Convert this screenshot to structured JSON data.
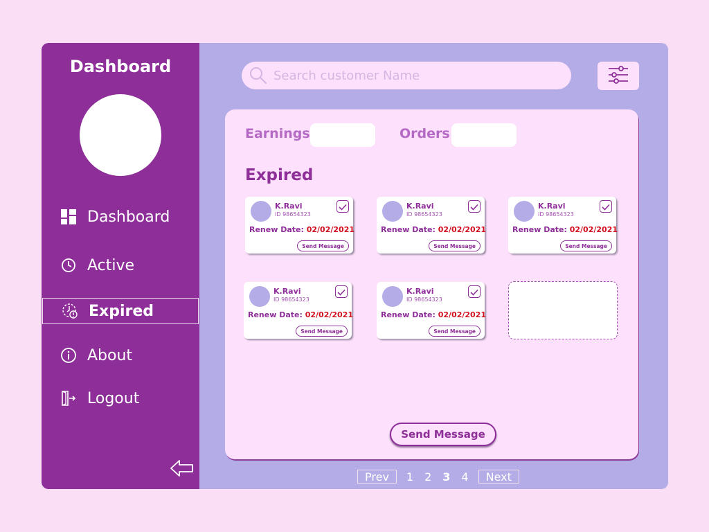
{
  "sidebar": {
    "title": "Dashboard",
    "items": [
      {
        "label": "Dashboard",
        "icon": "grid-icon"
      },
      {
        "label": "Active",
        "icon": "clock-icon"
      },
      {
        "label": "Expired",
        "icon": "expired-clock-icon"
      },
      {
        "label": "About",
        "icon": "info-icon"
      },
      {
        "label": "Logout",
        "icon": "logout-icon"
      }
    ],
    "active_item": "Expired"
  },
  "search": {
    "placeholder": "Search customer Name"
  },
  "stats": {
    "earnings_label": "Earnings",
    "orders_label": "Orders"
  },
  "section_title": "Expired",
  "cards": [
    {
      "name": "K.Ravi",
      "id": "ID 98654323",
      "renew_label": "Renew Date:",
      "renew_date": "02/02/2021",
      "button": "Send Message"
    },
    {
      "name": "K.Ravi",
      "id": "ID 98654323",
      "renew_label": "Renew Date:",
      "renew_date": "02/02/2021",
      "button": "Send Message"
    },
    {
      "name": "K.Ravi",
      "id": "ID 98654323",
      "renew_label": "Renew Date:",
      "renew_date": "02/02/2021",
      "button": "Send Message"
    },
    {
      "name": "K.Ravi",
      "id": "ID 98654323",
      "renew_label": "Renew Date:",
      "renew_date": "02/02/2021",
      "button": "Send Message"
    },
    {
      "name": "K.Ravi",
      "id": "ID 98654323",
      "renew_label": "Renew Date:",
      "renew_date": "02/02/2021",
      "button": "Send Message"
    }
  ],
  "send_message_label": "Send Message",
  "pagination": {
    "prev": "Prev",
    "next": "Next",
    "pages": [
      "1",
      "2",
      "3",
      "4"
    ],
    "current": "3"
  },
  "colors": {
    "sidebar": "#8e2f99",
    "background": "#f9def6",
    "panel": "#fde0fb",
    "accent": "#b3ace6",
    "date": "#d20f1f"
  }
}
